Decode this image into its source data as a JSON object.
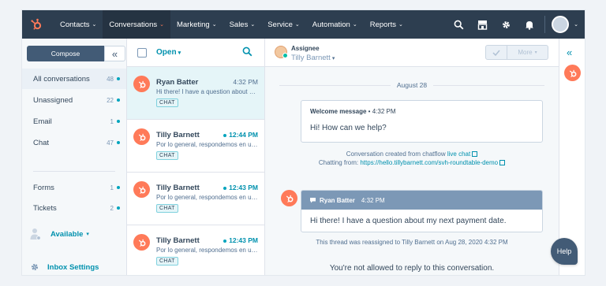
{
  "colors": {
    "nav_bg": "#2d3e50",
    "accent": "#ff7a59",
    "link": "#0091ae",
    "unread_dot": "#00a4bd"
  },
  "nav": {
    "logo_icon": "hubspot-sprocket-icon",
    "items": [
      {
        "label": "Contacts"
      },
      {
        "label": "Conversations",
        "active": true
      },
      {
        "label": "Marketing"
      },
      {
        "label": "Sales"
      },
      {
        "label": "Service"
      },
      {
        "label": "Automation"
      },
      {
        "label": "Reports"
      }
    ],
    "icons": [
      "search-icon",
      "marketplace-icon",
      "gear-icon",
      "bell-icon"
    ]
  },
  "sidebar": {
    "compose_label": "Compose",
    "folders": [
      {
        "label": "All conversations",
        "count": "48",
        "active": true
      },
      {
        "label": "Unassigned",
        "count": "22"
      },
      {
        "label": "Email",
        "count": "1"
      },
      {
        "label": "Chat",
        "count": "47"
      },
      {
        "label": "Forms",
        "count": "1"
      },
      {
        "label": "Tickets",
        "count": "2"
      }
    ],
    "availability": "Available",
    "settings_label": "Inbox Settings"
  },
  "list": {
    "filter_label": "Open",
    "conversations": [
      {
        "name": "Ryan Batter",
        "time": "4:32 PM",
        "preview": "Hi there! I have a question about my next payment date.",
        "tag": "CHAT",
        "active": true,
        "unread": false
      },
      {
        "name": "Tilly Barnett",
        "time": "12:44 PM",
        "preview": "Por lo general, respondemos en unos minutos.",
        "tag": "CHAT",
        "active": false,
        "unread": true
      },
      {
        "name": "Tilly Barnett",
        "time": "12:43 PM",
        "preview": "Por lo general, respondemos en unos minutos.",
        "tag": "CHAT",
        "active": false,
        "unread": true
      },
      {
        "name": "Tilly Barnett",
        "time": "12:43 PM",
        "preview": "Por lo general, respondemos en unos minutos.",
        "tag": "CHAT",
        "active": false,
        "unread": true
      }
    ]
  },
  "thread": {
    "assignee_label": "Assignee",
    "assignee_name": "Tilly Barnett",
    "more_label": "More",
    "date": "August 28",
    "welcome": {
      "title": "Welcome message",
      "time": "4:32 PM",
      "body": "Hi! How can we help?"
    },
    "system1": {
      "prefix": "Conversation created from chatflow",
      "link": "live chat",
      "chatting_prefix": "Chatting from:",
      "chatting_url": "https://hello.tillybarnett.com/svh-roundtable-demo"
    },
    "visitor": {
      "name": "Ryan Batter",
      "time": "4:32 PM",
      "body": "Hi there! I have a question about my next payment date."
    },
    "system2": "This thread was reassigned to Tilly Barnett on Aug 28, 2020 4:32 PM",
    "no_reply": "You're not allowed to reply to this conversation."
  },
  "help_label": "Help"
}
